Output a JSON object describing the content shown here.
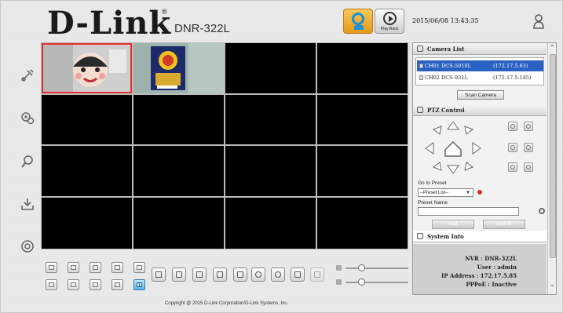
{
  "header": {
    "logo": "D-Link",
    "logo_reg": "®",
    "model": "DNR-322L",
    "live_label": "Live",
    "playback_label": "Play Back",
    "datetime": "2015/06/08 13:43:35"
  },
  "sidebar": {
    "items": [
      {
        "name": "setup",
        "icon": "tools-icon"
      },
      {
        "name": "maintenance",
        "icon": "gears-icon"
      },
      {
        "name": "search",
        "icon": "search-icon"
      },
      {
        "name": "download",
        "icon": "download-icon"
      },
      {
        "name": "about",
        "icon": "info-icon"
      }
    ]
  },
  "grid": {
    "rows": 4,
    "cols": 4,
    "selected_cell": 0
  },
  "camera_list": {
    "title": "Camera List",
    "cameras": [
      {
        "name": "CH01 DCS-5010L",
        "ip": "(172.17.5.63)",
        "selected": true
      },
      {
        "name": "CH02 DCS-931L",
        "ip": "(172.17.5.145)",
        "selected": false
      }
    ],
    "scan_label": "Scan Camera"
  },
  "ptz": {
    "title": "PTZ Control",
    "goto_preset_label": "Go to Preset",
    "preset_select_value": "--Preset List--",
    "preset_name_label": "Preset Name",
    "preset_name_value": "",
    "add_label": "Add",
    "add_all_label": "Add All"
  },
  "system_info": {
    "title": "System Info",
    "nvr": "NVR : DNR-322L",
    "user": "User : admin",
    "ip": "IP Address : 172.17.5.85",
    "pppoe": "PPPoE : Inactive"
  },
  "footer": {
    "copyright": "Copyright @ 2015 D-Link Corporation/D-Link Systems, Inc."
  },
  "colors": {
    "accent_live": "#e49a18",
    "selection": "#2a62c4",
    "selected_cell_border": "#e03030"
  }
}
